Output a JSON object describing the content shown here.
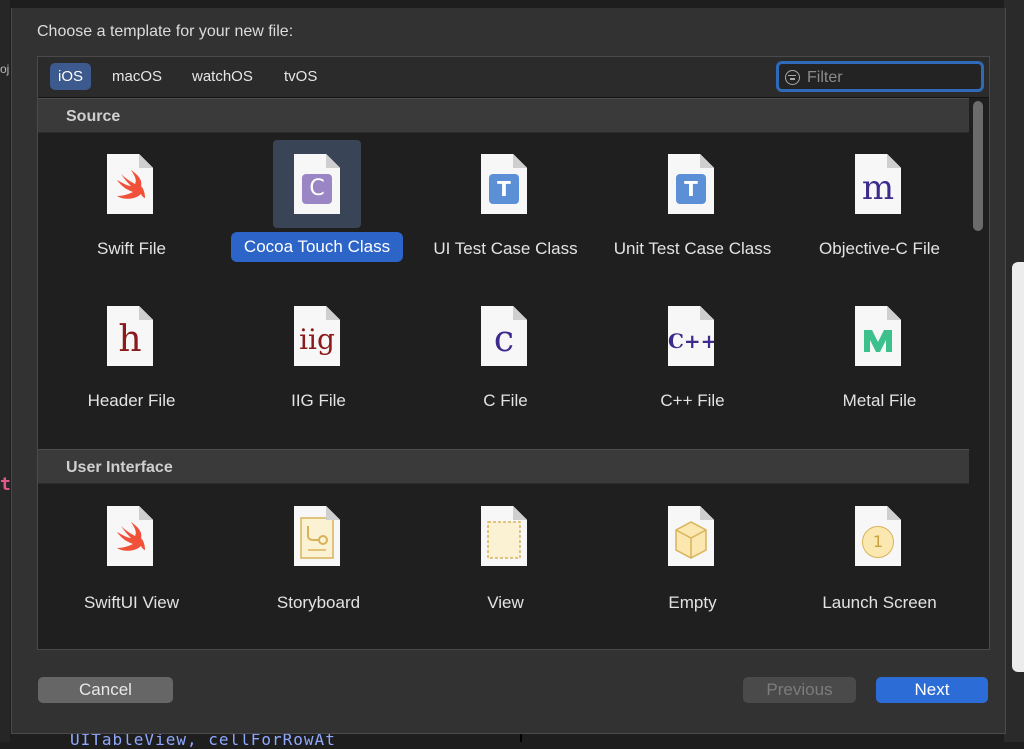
{
  "dialog": {
    "prompt": "Choose a template for your new file:",
    "filter_placeholder": "Filter"
  },
  "platform_tabs": [
    {
      "label": "iOS",
      "selected": true
    },
    {
      "label": "macOS",
      "selected": false
    },
    {
      "label": "watchOS",
      "selected": false
    },
    {
      "label": "tvOS",
      "selected": false
    }
  ],
  "sections": [
    {
      "title": "Source",
      "items": [
        {
          "label": "Swift File",
          "icon": "swift-icon"
        },
        {
          "label": "Cocoa Touch Class",
          "icon": "cocoa-touch-c-icon",
          "selected": true
        },
        {
          "label": "UI Test Case Class",
          "icon": "test-t-icon"
        },
        {
          "label": "Unit Test Case Class",
          "icon": "test-t-icon"
        },
        {
          "label": "Objective-C File",
          "icon": "objc-m-icon"
        },
        {
          "label": "Header File",
          "icon": "header-h-icon"
        },
        {
          "label": "IIG File",
          "icon": "iig-icon"
        },
        {
          "label": "C File",
          "icon": "c-icon"
        },
        {
          "label": "C++ File",
          "icon": "cpp-icon"
        },
        {
          "label": "Metal File",
          "icon": "metal-icon"
        }
      ]
    },
    {
      "title": "User Interface",
      "items": [
        {
          "label": "SwiftUI View",
          "icon": "swift-icon"
        },
        {
          "label": "Storyboard",
          "icon": "storyboard-icon"
        },
        {
          "label": "View",
          "icon": "view-icon"
        },
        {
          "label": "Empty",
          "icon": "empty-cube-icon"
        },
        {
          "label": "Launch Screen",
          "icon": "launch-screen-icon"
        }
      ]
    }
  ],
  "glyphs": {
    "c": "C",
    "t": "T",
    "m": "m",
    "h": "h",
    "iig": "iig",
    "cfile": "c",
    "cpp": "C++",
    "launch": "1"
  },
  "buttons": {
    "cancel": "Cancel",
    "previous": "Previous",
    "next": "Next"
  },
  "background": {
    "code_fragment": "UITableView, cellForRowAt",
    "left_fragment": "oj",
    "left_mark": "t"
  },
  "colors": {
    "accent": "#2c64c8",
    "swift": "#f05138",
    "objc_purple": "#3d2a8c",
    "header_red": "#8b1a1a",
    "metal_green": "#3cc08c"
  }
}
